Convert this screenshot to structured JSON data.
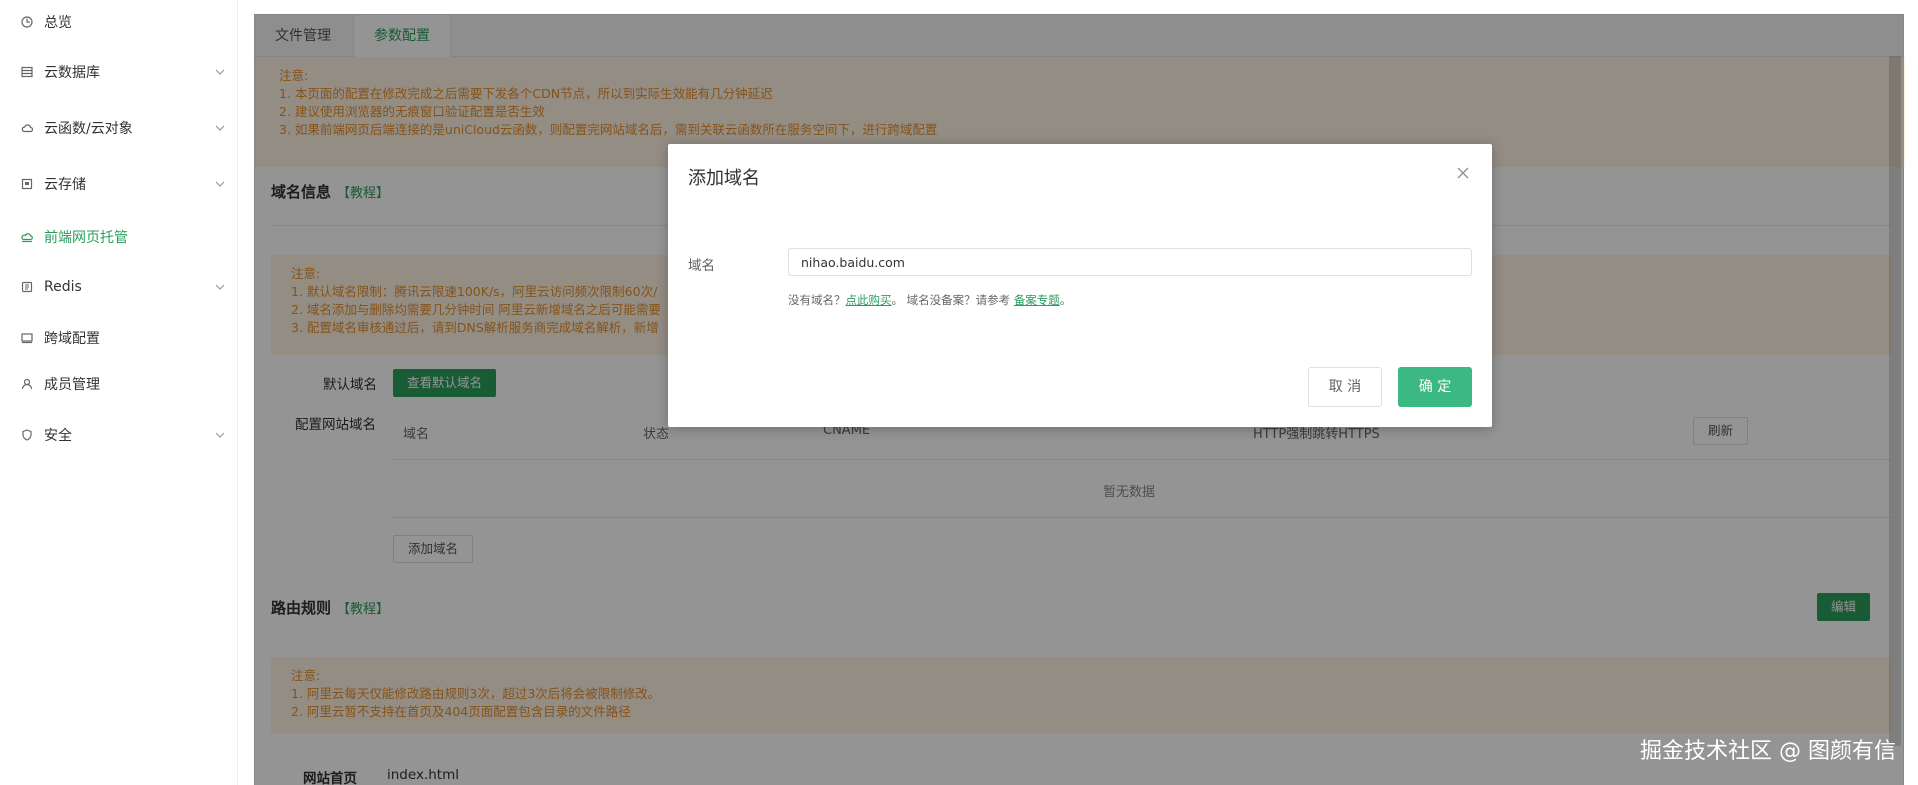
{
  "sidebar": {
    "items": [
      {
        "label": "总览",
        "icon": "dashboard-icon",
        "chevron": false,
        "active": false
      },
      {
        "label": "云数据库",
        "icon": "database-icon",
        "chevron": true,
        "active": false
      },
      {
        "label": "云函数/云对象",
        "icon": "cloud-icon",
        "chevron": true,
        "active": false
      },
      {
        "label": "云存储",
        "icon": "storage-icon",
        "chevron": true,
        "active": false
      },
      {
        "label": "前端网页托管",
        "icon": "hosting-icon",
        "chevron": false,
        "active": true
      },
      {
        "label": "Redis",
        "icon": "redis-icon",
        "chevron": true,
        "active": false
      },
      {
        "label": "跨域配置",
        "icon": "cors-icon",
        "chevron": false,
        "active": false
      },
      {
        "label": "成员管理",
        "icon": "user-icon",
        "chevron": false,
        "active": false
      },
      {
        "label": "安全",
        "icon": "shield-icon",
        "chevron": true,
        "active": false
      }
    ]
  },
  "tabs": [
    {
      "label": "文件管理",
      "active": false
    },
    {
      "label": "参数配置",
      "active": true
    }
  ],
  "notice_top": {
    "lines": [
      "注意:",
      "1. 本页面的配置在修改完成之后需要下发各个CDN节点，所以到实际生效能有几分钟延迟",
      "2. 建议使用浏览器的无痕窗口验证配置是否生效",
      "3. 如果前端网页后端连接的是uniCloud云函数，则配置完网站域名后，需到关联云函数所在服务空间下，进行跨域配置"
    ]
  },
  "domain_section": {
    "title": "域名信息",
    "tutorial": "【教程】",
    "notice_lines": [
      "注意:",
      "1. 默认域名限制：腾讯云限速100K/s，阿里云访问频次限制60次/",
      "2. 域名添加与删除均需要几分钟时间 阿里云新增域名之后可能需要",
      "3. 配置域名审核通过后，请到DNS解析服务商完成域名解析，新增"
    ],
    "default_domain_label": "默认域名",
    "view_default_button": "查看默认域名",
    "config_domain_label": "配置网站域名",
    "columns": [
      "域名",
      "状态",
      "CNAME",
      "HTTP强制跳转HTTPS"
    ],
    "refresh_button": "刷新",
    "empty_text": "暂无数据",
    "add_domain_button": "添加域名"
  },
  "route_section": {
    "title": "路由规则",
    "tutorial": "【教程】",
    "edit_button": "编辑",
    "notice_lines": [
      "注意:",
      "1. 阿里云每天仅能修改路由规则3次，超过3次后将会被限制修改。",
      "2. 阿里云暂不支持在首页及404页面配置包含目录的文件路径"
    ],
    "index_label": "网站首页",
    "index_value": "index.html"
  },
  "modal": {
    "title": "添加域名",
    "field_label": "域名",
    "field_value": "nihao.baidu.com",
    "hint_prefix": "没有域名？",
    "hint_buy": "点此购买",
    "hint_middle": "。 域名没备案？请参考 ",
    "hint_beian": "备案专题",
    "hint_suffix": "。",
    "cancel": "取 消",
    "confirm": "确 定"
  },
  "watermark": "掘金技术社区 @ 图颜有信",
  "colors": {
    "accent": "#2a9d5c",
    "notice_bg": "#fdf3e3",
    "notice_text": "#e6902e",
    "confirm": "#3cb882"
  }
}
